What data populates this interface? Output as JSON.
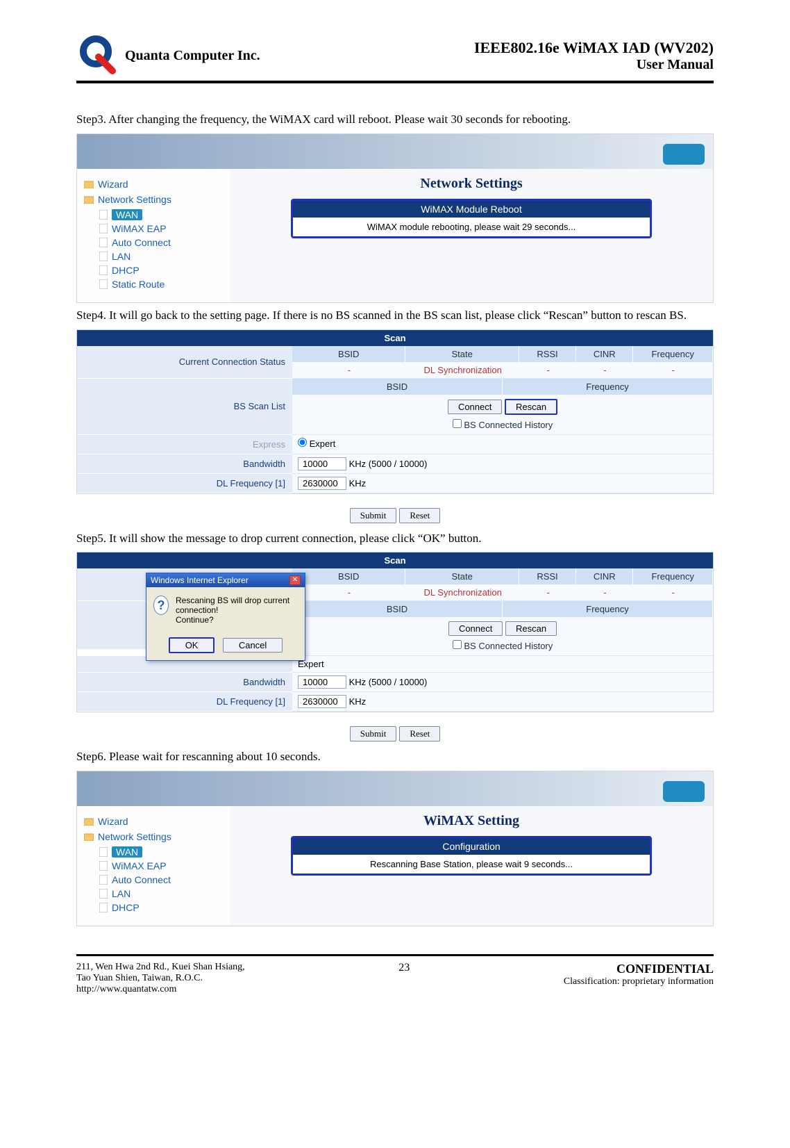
{
  "header": {
    "company": "Quanta  Computer  Inc.",
    "product": "IEEE802.16e  WiMAX  IAD  (WV202)",
    "subtitle": "User  Manual"
  },
  "steps": {
    "s3": "Step3. After changing the frequency, the WiMAX card will reboot. Please wait 30 seconds for rebooting.",
    "s4": "Step4. It will go back to the setting page. If there is no BS scanned in the BS scan list, please click “Rescan” button to rescan BS.",
    "s5": "Step5. It will show the message to drop current connection, please click “OK” button.",
    "s6": "Step6. Please wait for rescanning about 10 seconds."
  },
  "nav": {
    "wizard": "Wizard",
    "netset": "Network Settings",
    "wan": "WAN",
    "wimaxeap": "WiMAX EAP",
    "autoconn": "Auto Connect",
    "lan": "LAN",
    "dhcp": "DHCP",
    "static": "Static Route"
  },
  "shot1": {
    "section_title": "Network Settings",
    "panel_head": "WiMAX Module Reboot",
    "panel_body": "WiMAX module rebooting, please wait 29 seconds..."
  },
  "scan": {
    "title": "Scan",
    "ccs": "Current Connection Status",
    "bslist": "BS Scan List",
    "headers": {
      "bsid": "BSID",
      "state": "State",
      "rssi": "RSSI",
      "cinr": "CINR",
      "freq": "Frequency"
    },
    "dlsync": "DL Synchronization",
    "dash": "-",
    "connect": "Connect",
    "rescan": "Rescan",
    "bs_history": "BS Connected History",
    "express": "Express",
    "expert": "Expert",
    "bandwidth": "Bandwidth",
    "bw_val": "10000",
    "bw_unit": "KHz (5000 / 10000)",
    "dlfreq": "DL Frequency [1]",
    "dlfreq_val": "2630000",
    "khz": "KHz",
    "submit": "Submit",
    "reset": "Reset"
  },
  "dialog": {
    "title": "Windows Internet Explorer",
    "msg1": "Rescaning BS will drop current connection!",
    "msg2": "Continue?",
    "ok": "OK",
    "cancel": "Cancel"
  },
  "shot3": {
    "section_title": "WiMAX Setting",
    "panel_head": "Configuration",
    "panel_body": "Rescanning Base Station, please wait 9 seconds..."
  },
  "footer": {
    "addr1": "211, Wen Hwa 2nd Rd., Kuei Shan Hsiang,",
    "addr2": "Tao Yuan Shien, Taiwan, R.O.C.",
    "url": "http://www.quantatw.com",
    "page": "23",
    "conf": "CONFIDENTIAL",
    "class": "Classification: proprietary information"
  }
}
